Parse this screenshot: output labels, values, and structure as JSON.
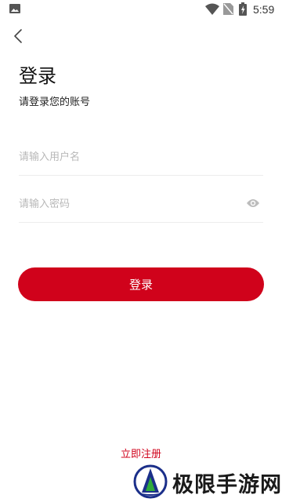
{
  "status_bar": {
    "time": "5:59",
    "icons": [
      "gallery-icon",
      "wifi-icon",
      "sim-icon",
      "battery-icon"
    ]
  },
  "header": {
    "back_icon": "chevron-left-icon"
  },
  "main": {
    "title": "登录",
    "subtitle": "请登录您的账号",
    "username": {
      "value": "",
      "placeholder": "请输入用户名"
    },
    "password": {
      "value": "",
      "placeholder": "请输入密码",
      "toggle_icon": "eye-icon"
    },
    "login_button": "登录",
    "register_link": "立即注册"
  },
  "watermark": {
    "brand": "极限手游网"
  },
  "colors": {
    "accent": "#d0021b",
    "placeholder": "#b8b8b8",
    "divider": "#ececec"
  }
}
